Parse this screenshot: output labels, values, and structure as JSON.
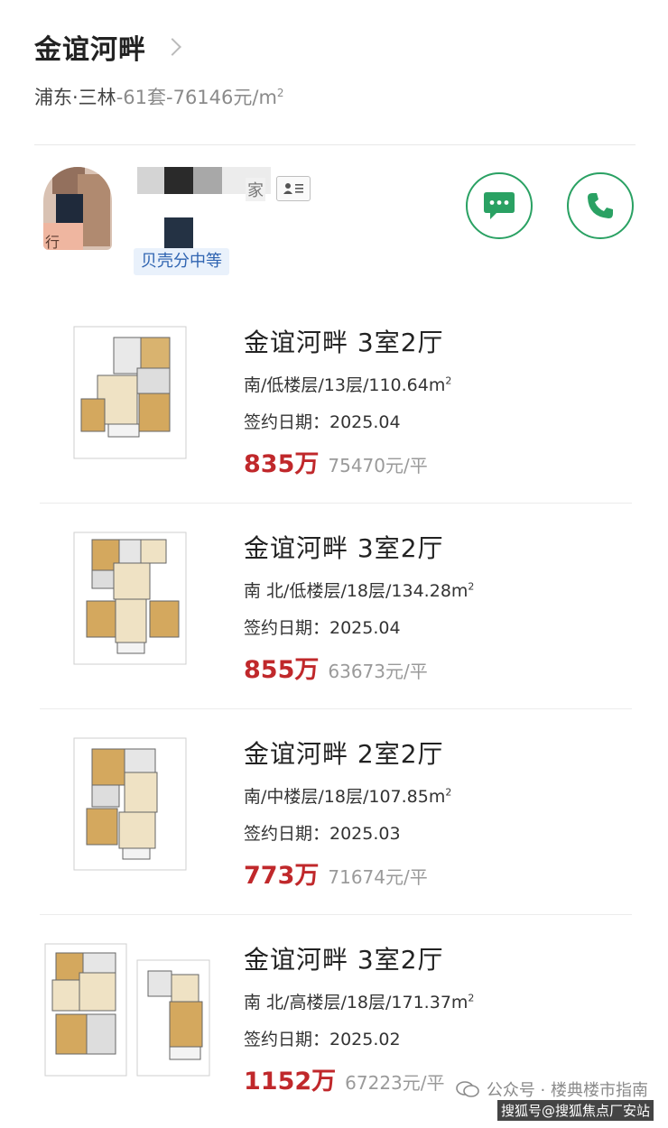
{
  "header": {
    "title": "金谊河畔",
    "location": "浦东·三林",
    "stats_separator": "-",
    "deal_count": "61套",
    "avg_price_prefix": "76146元/m",
    "avg_price_sup": "2"
  },
  "agent": {
    "name_suffix": "家",
    "avatar_tag": "行",
    "badge": "贝壳分中等",
    "card_icon": "id-card-icon",
    "chat_icon": "chat-bubble-icon",
    "phone_icon": "phone-icon",
    "accent_color": "#2aa163"
  },
  "listings": [
    {
      "title": "金谊河畔 3室2厅",
      "spec": "南/低楼层/13层/110.64m",
      "spec_sup": "2",
      "date": "签约日期：2025.04",
      "price": "835万",
      "unit_price": "75470元/平"
    },
    {
      "title": "金谊河畔 3室2厅",
      "spec": "南 北/低楼层/18层/134.28m",
      "spec_sup": "2",
      "date": "签约日期：2025.04",
      "price": "855万",
      "unit_price": "63673元/平"
    },
    {
      "title": "金谊河畔 2室2厅",
      "spec": "南/中楼层/18层/107.85m",
      "spec_sup": "2",
      "date": "签约日期：2025.03",
      "price": "773万",
      "unit_price": "71674元/平"
    },
    {
      "title": "金谊河畔 3室2厅",
      "spec": "南 北/高楼层/18层/171.37m",
      "spec_sup": "2",
      "date": "签约日期：2025.02",
      "price": "1152万",
      "unit_price": "67223元/平"
    }
  ],
  "watermark": {
    "text": "公众号 · 楼典楼市指南",
    "sub": "搜狐号@搜狐焦点厂安站"
  },
  "colors": {
    "price": "#c0282b",
    "badge_text": "#2f64b1",
    "badge_bg": "#e9f1fb"
  }
}
